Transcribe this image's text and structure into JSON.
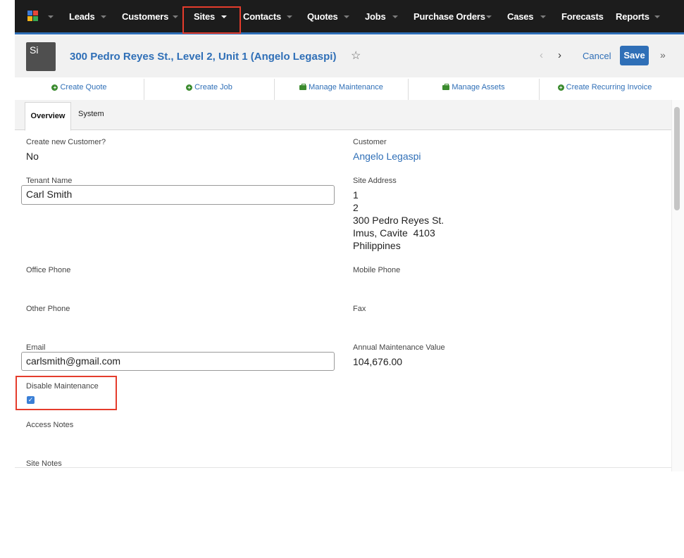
{
  "nav": {
    "items": [
      "Leads",
      "Customers",
      "Sites",
      "Contacts",
      "Quotes",
      "Jobs",
      "Purchase Orders",
      "Cases",
      "Forecasts",
      "Reports"
    ],
    "active": "Sites"
  },
  "record": {
    "avatar": "Si",
    "title": "300 Pedro Reyes St., Level 2, Unit 1 (Angelo Legaspi)",
    "star_icon": "☆",
    "prev_icon": "‹",
    "next_icon": "›",
    "cancel_label": "Cancel",
    "save_label": "Save",
    "more_icon": "»"
  },
  "actions": [
    "Create Quote",
    "Create Job",
    "Manage Maintenance",
    "Manage Assets",
    "Create Recurring Invoice"
  ],
  "tabs": [
    "Overview",
    "System"
  ],
  "fields": {
    "create_new_customer": {
      "label": "Create new Customer?",
      "value": "No"
    },
    "customer": {
      "label": "Customer",
      "value": "Angelo Legaspi"
    },
    "tenant_name": {
      "label": "Tenant Name",
      "value": "Carl Smith"
    },
    "site_address": {
      "label": "Site Address",
      "lines": [
        "1",
        "2",
        "300 Pedro Reyes St.",
        "Imus, Cavite  4103",
        "Philippines"
      ]
    },
    "office_phone": {
      "label": "Office Phone",
      "value": ""
    },
    "mobile_phone": {
      "label": "Mobile Phone",
      "value": ""
    },
    "other_phone": {
      "label": "Other Phone",
      "value": ""
    },
    "fax": {
      "label": "Fax",
      "value": ""
    },
    "email": {
      "label": "Email",
      "value": "carlsmith@gmail.com"
    },
    "annual_maintenance_value": {
      "label": "Annual Maintenance Value",
      "value": "104,676.00"
    },
    "disable_maintenance": {
      "label": "Disable Maintenance",
      "checked": true
    },
    "access_notes": {
      "label": "Access Notes",
      "value": ""
    },
    "site_notes": {
      "label": "Site Notes",
      "value": ""
    }
  },
  "colors": {
    "nav_bg": "#1c1c1c",
    "accent": "#2f6fb7",
    "action_icon": "#3b8b2e",
    "highlight": "#e53c2c",
    "checkbox": "#3a7fd6"
  }
}
